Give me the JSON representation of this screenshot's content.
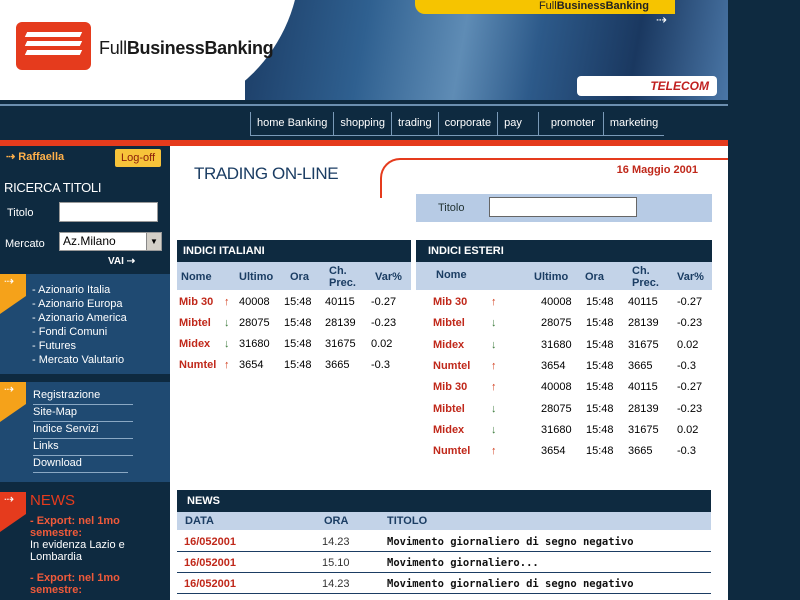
{
  "header": {
    "brand_plain": "Full",
    "brand_bold": "BusinessBanking",
    "banner_plain": "Full",
    "banner_bold": "BusinessBanking",
    "telecom": "TELECOM"
  },
  "nav": [
    "home Banking",
    "shopping",
    "trading",
    "corporate",
    "pay",
    "promoter",
    "marketing"
  ],
  "user": {
    "name": "Raffaella",
    "logoff": "Log-off"
  },
  "search": {
    "title": "RICERCA TITOLI",
    "titolo_label": "Titolo",
    "mercato_label": "Mercato",
    "mercato_value": "Az.Milano",
    "vai": "VAI"
  },
  "menu1": [
    "- Azionario Italia",
    "- Azionario Europa",
    "- Azionario America",
    "- Fondi Comuni",
    "- Futures",
    "- Mercato Valutario"
  ],
  "menu2": [
    "Registrazione",
    "Site-Map",
    "Indice Servizi",
    "Links",
    "Download"
  ],
  "news_side": {
    "title": "NEWS",
    "items": [
      {
        "head": "- Export: nel 1mo semestre:",
        "text": "In evidenza Lazio e Lombardia"
      },
      {
        "head": "- Export: nel 1mo semestre:",
        "text": ""
      }
    ]
  },
  "main": {
    "title": "TRADING ON-LINE",
    "date": "16 Maggio 2001",
    "search_label": "Titolo"
  },
  "columns": {
    "nome": "Nome",
    "ultimo": "Ultimo",
    "ora": "Ora",
    "ch1": "Ch.",
    "ch2": "Prec.",
    "var": "Var%"
  },
  "indici_italiani": {
    "title": "INDICI ITALIANI",
    "rows": [
      {
        "nome": "Mib 30",
        "dir": "up",
        "ultimo": "40008",
        "ora": "15:48",
        "prec": "40115",
        "var": "-0.27"
      },
      {
        "nome": "Mibtel",
        "dir": "down",
        "ultimo": "28075",
        "ora": "15:48",
        "prec": "28139",
        "var": "-0.23"
      },
      {
        "nome": "Midex",
        "dir": "down",
        "ultimo": "31680",
        "ora": "15:48",
        "prec": "31675",
        "var": "0.02"
      },
      {
        "nome": "Numtel",
        "dir": "up",
        "ultimo": "3654",
        "ora": "15:48",
        "prec": "3665",
        "var": "-0.3"
      }
    ]
  },
  "indici_esteri": {
    "title": "INDICI ESTERI",
    "rows": [
      {
        "nome": "Mib 30",
        "dir": "up",
        "ultimo": "40008",
        "ora": "15:48",
        "prec": "40115",
        "var": "-0.27"
      },
      {
        "nome": "Mibtel",
        "dir": "down",
        "ultimo": "28075",
        "ora": "15:48",
        "prec": "28139",
        "var": "-0.23"
      },
      {
        "nome": "Midex",
        "dir": "down",
        "ultimo": "31680",
        "ora": "15:48",
        "prec": "31675",
        "var": "0.02"
      },
      {
        "nome": "Numtel",
        "dir": "up",
        "ultimo": "3654",
        "ora": "15:48",
        "prec": "3665",
        "var": "-0.3"
      },
      {
        "nome": "Mib 30",
        "dir": "up",
        "ultimo": "40008",
        "ora": "15:48",
        "prec": "40115",
        "var": "-0.27"
      },
      {
        "nome": "Mibtel",
        "dir": "down",
        "ultimo": "28075",
        "ora": "15:48",
        "prec": "28139",
        "var": "-0.23"
      },
      {
        "nome": "Midex",
        "dir": "down",
        "ultimo": "31680",
        "ora": "15:48",
        "prec": "31675",
        "var": "0.02"
      },
      {
        "nome": "Numtel",
        "dir": "up",
        "ultimo": "3654",
        "ora": "15:48",
        "prec": "3665",
        "var": "-0.3"
      }
    ]
  },
  "news": {
    "title": "NEWS",
    "col_data": "DATA",
    "col_ora": "ORA",
    "col_titolo": "TITOLO",
    "rows": [
      {
        "data": "16/052001",
        "ora": "14.23",
        "titolo": "Movimento giornaliero di segno negativo"
      },
      {
        "data": "16/052001",
        "ora": "15.10",
        "titolo": "Movimento giornaliero..."
      },
      {
        "data": "16/052001",
        "ora": "14.23",
        "titolo": "Movimento giornaliero di segno negativo"
      }
    ]
  },
  "colors": {
    "navy": "#0e2a40",
    "accent_red": "#e53b1d",
    "header_blue": "#c3d3e8",
    "gold": "#f6c400"
  }
}
